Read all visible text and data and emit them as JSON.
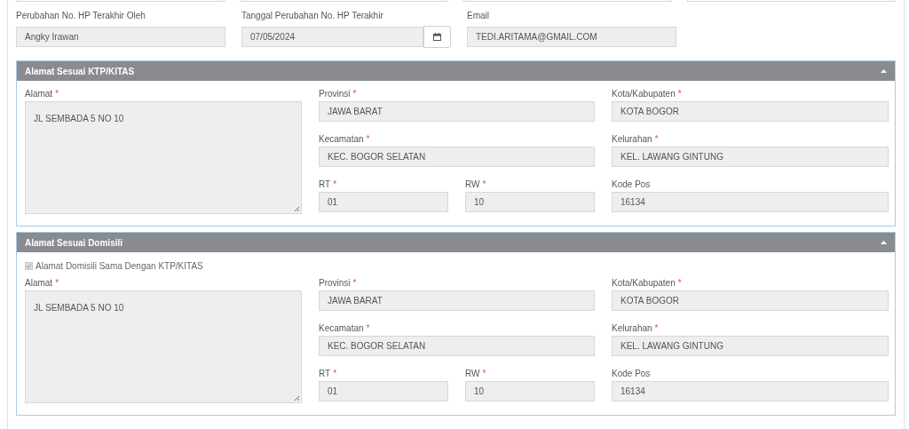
{
  "top_fields": [
    {
      "label": "Perubahan No. HP Terakhir Oleh",
      "value": "Angky Irawan",
      "kind": "text"
    },
    {
      "label": "Tanggal Perubahan No. HP Terakhir",
      "value": "07/05/2024",
      "kind": "date"
    },
    {
      "label": "Email",
      "value": "TEDI.ARITAMA@GMAIL.COM",
      "kind": "text"
    }
  ],
  "sections": [
    {
      "title": "Alamat Sesuai KTP/KITAS",
      "expanded": true,
      "fields": [
        {
          "label": "Alamat",
          "mark": "*",
          "value": "JL SEMBADA 5 NO 10",
          "kind": "textarea"
        },
        {
          "label": "Provinsi",
          "mark": "*",
          "value": "JAWA BARAT",
          "kind": "wide"
        },
        {
          "label": "Kota/Kabupaten",
          "mark": "*",
          "value": "KOTA BOGOR",
          "kind": "text"
        },
        {
          "label": "Kecamatan",
          "mark": "*",
          "value": "KEC. BOGOR SELATAN",
          "kind": "wide"
        },
        {
          "label": "Kelurahan",
          "mark": "*",
          "value": "KEL. LAWANG GINTUNG",
          "kind": "text"
        },
        {
          "label": "RT",
          "mark": "*",
          "value": "01",
          "kind": "text"
        },
        {
          "label": "RW",
          "mark": "*",
          "value": "10",
          "kind": "text"
        },
        {
          "label": "Kode Pos",
          "value": "16134",
          "kind": "text"
        }
      ]
    },
    {
      "title": "Alamat Sesuai Domisili",
      "expanded": true,
      "checkbox": {
        "label": "Alamat Domisili Sama Dengan KTP/KITAS",
        "checked": true,
        "disabled": true
      },
      "fields": [
        {
          "label": "Alamat",
          "mark": "*",
          "value": "JL SEMBADA 5 NO 10",
          "kind": "textarea"
        },
        {
          "label": "Provinsi",
          "mark": "*",
          "value": "JAWA BARAT",
          "kind": "wide"
        },
        {
          "label": "Kota/Kabupaten",
          "mark": "*",
          "value": "KOTA BOGOR",
          "kind": "text"
        },
        {
          "label": "Kecamatan",
          "mark": "*",
          "value": "KEC. BOGOR SELATAN",
          "kind": "wide"
        },
        {
          "label": "Kelurahan",
          "mark": "*",
          "value": "KEL. LAWANG GINTUNG",
          "kind": "text"
        },
        {
          "label": "RT",
          "mark": "*",
          "value": "01",
          "kind": "text"
        },
        {
          "label": "RW",
          "mark": "*",
          "value": "10",
          "kind": "text"
        },
        {
          "label": "Kode Pos",
          "value": "16134",
          "kind": "text"
        }
      ]
    }
  ]
}
